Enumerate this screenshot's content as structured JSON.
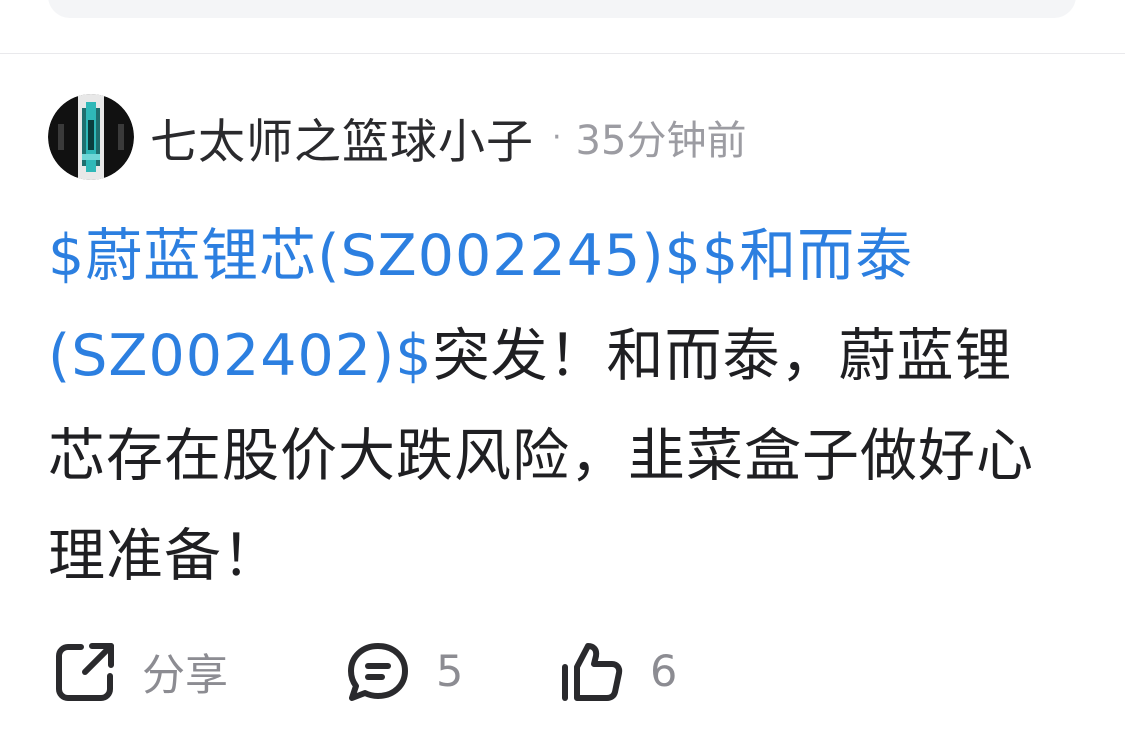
{
  "post": {
    "author": "七太师之篮球小子",
    "separator": "·",
    "time": "35分钟前",
    "stock1": "$蔚蓝锂芯(SZ002245)$",
    "stock2": "$和而泰(SZ002402)$",
    "text": "突发！和而泰，蔚蓝锂芯存在股价大跌风险，韭菜盒子做好心理准备！"
  },
  "actions": {
    "share_label": "分享",
    "comment_count": "5",
    "like_count": "6"
  },
  "colors": {
    "link": "#2c7fe0",
    "text": "#1f1f22",
    "muted": "#9c9ca2"
  },
  "icons": {
    "share": "share-icon",
    "comment": "comment-icon",
    "like": "thumbs-up-icon"
  }
}
